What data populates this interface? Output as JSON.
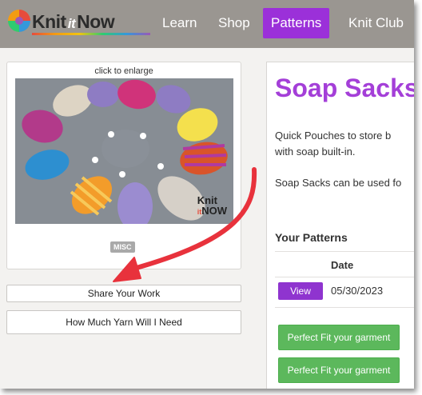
{
  "nav": {
    "logo_text_a": "Knit",
    "logo_text_b": "it",
    "logo_text_c": "Now",
    "items": [
      {
        "label": "Learn"
      },
      {
        "label": "Shop"
      },
      {
        "label": "Patterns"
      },
      {
        "label": "Knit Club"
      }
    ]
  },
  "image_card": {
    "enlarge_label": "click to enlarge",
    "photo_watermark_a": "Knit",
    "photo_watermark_b": "it",
    "photo_watermark_c": "NOW",
    "tag": "MISC"
  },
  "buttons": {
    "share": "Share Your Work",
    "yarn": "How Much Yarn Will I Need"
  },
  "pattern": {
    "title": "Soap Sacks",
    "desc_line1": "Quick Pouches to store b",
    "desc_line2": "with soap built-in.",
    "desc_line3": "Soap Sacks can be used fo"
  },
  "your_patterns": {
    "heading": "Your Patterns",
    "date_header": "Date",
    "rows": [
      {
        "action": "View",
        "date": "05/30/2023"
      }
    ],
    "fit_buttons": [
      "Perfect Fit your garment",
      "Perfect Fit your garment"
    ]
  },
  "colors": {
    "nav_bg": "#9a9691",
    "accent_purple": "#9b30d9",
    "title_purple": "#a43fd8",
    "green": "#5cb85c",
    "annotation_arrow": "#e8323c"
  }
}
